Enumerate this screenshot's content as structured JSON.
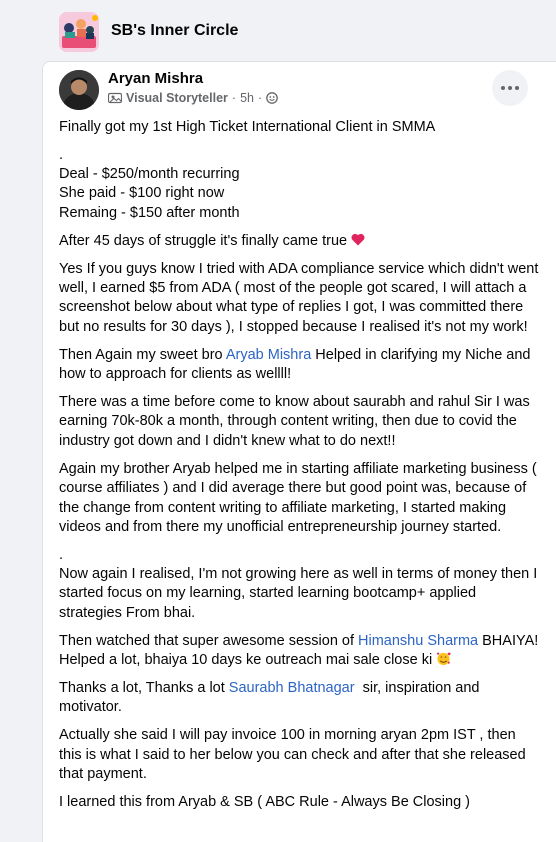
{
  "group": {
    "name": "SB's Inner Circle"
  },
  "post": {
    "author": "Aryan Mishra",
    "badge": "Visual Storyteller",
    "time": "5h",
    "separator": "·",
    "paragraphs": {
      "p1": "Finally got my 1st High Ticket International Client in SMMA",
      "dot1": ".",
      "deal1": "Deal - $250/month recurring",
      "deal2": "She paid - $100 right now",
      "deal3": "Remaing - $150 after month",
      "p2": "After 45 days of struggle it's finally came true",
      "p3": "Yes If you guys know I tried with ADA compliance service which didn't went well, I earned $5 from ADA ( most of the people got scared, I will attach a screenshot below about what type of replies I got, I was committed there but no results for 30 days ), I stopped because I realised it's not my work!",
      "p4a": "Then Again my sweet bro ",
      "p4link": "Aryab Mishra",
      "p4b": " Helped in clarifying my Niche and how to approach for clients as wellll!",
      "p5": "There was a time before come to know about saurabh and rahul Sir I was earning 70k-80k a month, through content writing, then due to covid the industry got down and I didn't knew what to do next!!",
      "p6": "Again my brother Aryab helped me in starting affiliate marketing business ( course affiliates ) and I did average there but good point was, because of the change from content writing to affiliate marketing, I started making videos and from there my unofficial entrepreneurship journey started.",
      "dot2": ".",
      "p7": "Now again I realised, I'm not growing here as well in terms of money then I started focus on my learning, started learning bootcamp+ applied strategies From bhai.",
      "p8a": "Then watched that super awesome session of ",
      "p8link": "Himanshu Sharma",
      "p8b": " BHAIYA! Helped a lot, bhaiya 10 days ke outreach mai sale close ki",
      "p9a": "Thanks a lot, Thanks a lot ",
      "p9link": "Saurabh Bhatnagar",
      "p9b": "  sir, inspiration and motivator.",
      "p10": "Actually she said I will pay invoice 100  in morning aryan 2pm IST , then this is what I said to her below you can check and after that she released that payment.",
      "p11": "I learned this from Aryab & SB ( ABC Rule - Always Be Closing )"
    }
  },
  "colors": {
    "link": "#2c64c6",
    "meta_text": "#65676b",
    "background": "#f0f2f5"
  },
  "icons": {
    "badge": "visual-storyteller-badge-icon",
    "privacy": "public-globe-icon",
    "more": "more-horizontal-icon",
    "heart": "red-heart-emoji-icon",
    "emoji": "smiling-face-with-hearts-emoji-icon"
  }
}
